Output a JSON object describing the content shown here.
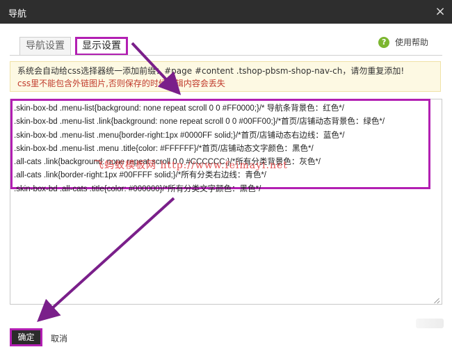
{
  "dialog": {
    "title": "导航",
    "close_icon": "×"
  },
  "tabs": [
    {
      "label": "导航设置",
      "active": false
    },
    {
      "label": "显示设置",
      "active": true
    }
  ],
  "help": {
    "icon": "?",
    "label": "使用帮助"
  },
  "notice": {
    "line1": "系统会自动给css选择器统一添加前缀：#page #content .tshop-pbsm-shop-nav-ch，请勿重复添加!",
    "line2": "css里不能包含外链图片,否则保存的时候编辑内容会丢失"
  },
  "code_lines": [
    ".skin-box-bd .menu-list{background: none repeat scroll 0 0 #FF0000;}/* 导航条背景色：红色*/",
    ".skin-box-bd .menu-list .link{background: none repeat scroll 0 0 #00FF00;}/*首页/店铺动态背景色：绿色*/",
    ".skin-box-bd .menu-list .menu{border-right:1px #0000FF solid;}/*首页/店铺动态右边线：蓝色*/",
    ".skin-box-bd .menu-list .menu .title{color: #FFFFFF}/*首页/店铺动态文字颜色：黑色*/",
    ".all-cats .link{background: none repeat scroll 0 0 #CCCCCC;}/*所有分类背景色：灰色*/",
    ".all-cats .link{border-right:1px #00FFFF solid;}/*所有分类右边线：青色*/",
    ".skin-box-bd .all-cats .title{color: #000000}/*所有分类文字颜色：黑色*/"
  ],
  "watermark": "飞蚂蚁模板网 http://www.feimayi.net",
  "buttons": {
    "ok": "确定",
    "cancel": "取消"
  },
  "colors": {
    "highlight": "#b21fb2",
    "titlebar": "#2e2e2e",
    "notice_bg": "#fdf9e3",
    "warning_text": "#c0392b"
  }
}
